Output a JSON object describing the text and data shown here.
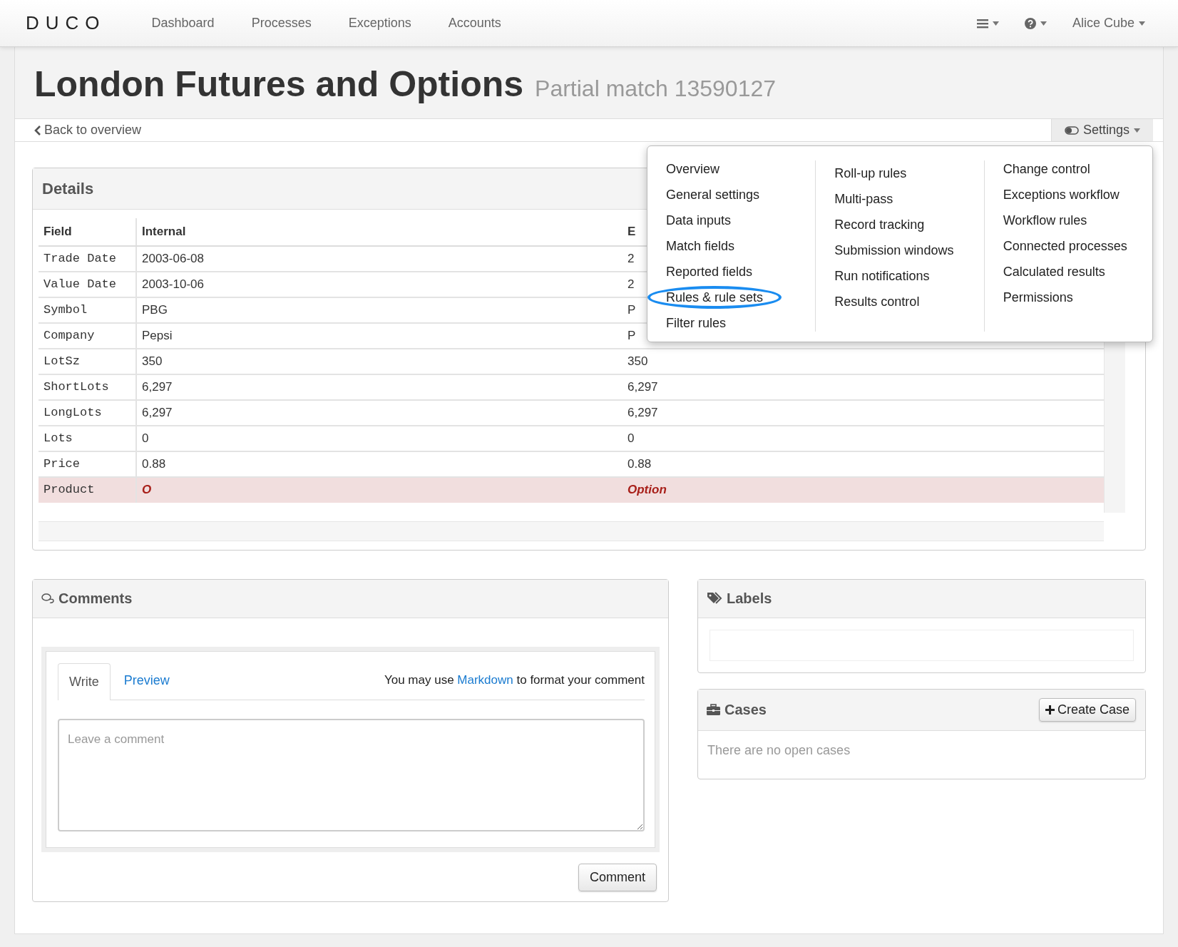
{
  "navbar": {
    "brand": "DUCO",
    "links": [
      "Dashboard",
      "Processes",
      "Exceptions",
      "Accounts"
    ],
    "user": "Alice Cube"
  },
  "page": {
    "title": "London Futures and Options",
    "subtitle": "Partial match 13590127"
  },
  "subnav": {
    "back": "Back to overview",
    "settings": "Settings",
    "settings_open": true
  },
  "settings_menu": {
    "columns": [
      [
        {
          "label": "Overview",
          "highlighted": false
        },
        {
          "label": "General settings",
          "highlighted": false
        },
        {
          "label": "Data inputs",
          "highlighted": false
        },
        {
          "label": "Match fields",
          "highlighted": false
        },
        {
          "label": "Reported fields",
          "highlighted": false
        },
        {
          "label": "Rules & rule sets",
          "highlighted": true
        },
        {
          "label": "Filter rules",
          "highlighted": false
        }
      ],
      [
        {
          "label": "Roll-up rules",
          "highlighted": false
        },
        {
          "label": "Multi-pass",
          "highlighted": false
        },
        {
          "label": "Record tracking",
          "highlighted": false
        },
        {
          "label": "Submission windows",
          "highlighted": false
        },
        {
          "label": "Run notifications",
          "highlighted": false
        },
        {
          "label": "Results control",
          "highlighted": false
        }
      ],
      [
        {
          "label": "Change control",
          "highlighted": false
        },
        {
          "label": "Exceptions workflow",
          "highlighted": false
        },
        {
          "label": "Workflow rules",
          "highlighted": false
        },
        {
          "label": "Connected processes",
          "highlighted": false
        },
        {
          "label": "Calculated results",
          "highlighted": false
        },
        {
          "label": "Permissions",
          "highlighted": false
        }
      ]
    ]
  },
  "details": {
    "title": "Details",
    "columns": [
      "Field",
      "Internal",
      "E"
    ],
    "rows": [
      {
        "cells": [
          "Trade Date",
          "2003-06-08",
          "2"
        ],
        "mismatch": false
      },
      {
        "cells": [
          "Value Date",
          "2003-10-06",
          "2"
        ],
        "mismatch": false
      },
      {
        "cells": [
          "Symbol",
          "PBG",
          "P"
        ],
        "mismatch": false
      },
      {
        "cells": [
          "Company",
          "Pepsi",
          "P"
        ],
        "mismatch": false
      },
      {
        "cells": [
          "LotSz",
          "350",
          "350"
        ],
        "mismatch": false
      },
      {
        "cells": [
          "ShortLots",
          "6,297",
          "6,297"
        ],
        "mismatch": false
      },
      {
        "cells": [
          "LongLots",
          "6,297",
          "6,297"
        ],
        "mismatch": false
      },
      {
        "cells": [
          "Lots",
          "0",
          "0"
        ],
        "mismatch": false
      },
      {
        "cells": [
          "Price",
          "0.88",
          "0.88"
        ],
        "mismatch": false
      },
      {
        "cells": [
          "Product",
          "O",
          "Option"
        ],
        "mismatch": true
      }
    ]
  },
  "comments": {
    "title": "Comments",
    "tabs": [
      {
        "label": "Write",
        "selected": true
      },
      {
        "label": "Preview",
        "selected": false
      }
    ],
    "hint_before": "You may use",
    "hint_link": "Markdown",
    "hint_after": "to format your comment",
    "placeholder": "Leave a comment",
    "button": "Comment"
  },
  "labels": {
    "title": "Labels"
  },
  "cases": {
    "title": "Cases",
    "button": "Create Case",
    "empty": "There are no open cases"
  }
}
